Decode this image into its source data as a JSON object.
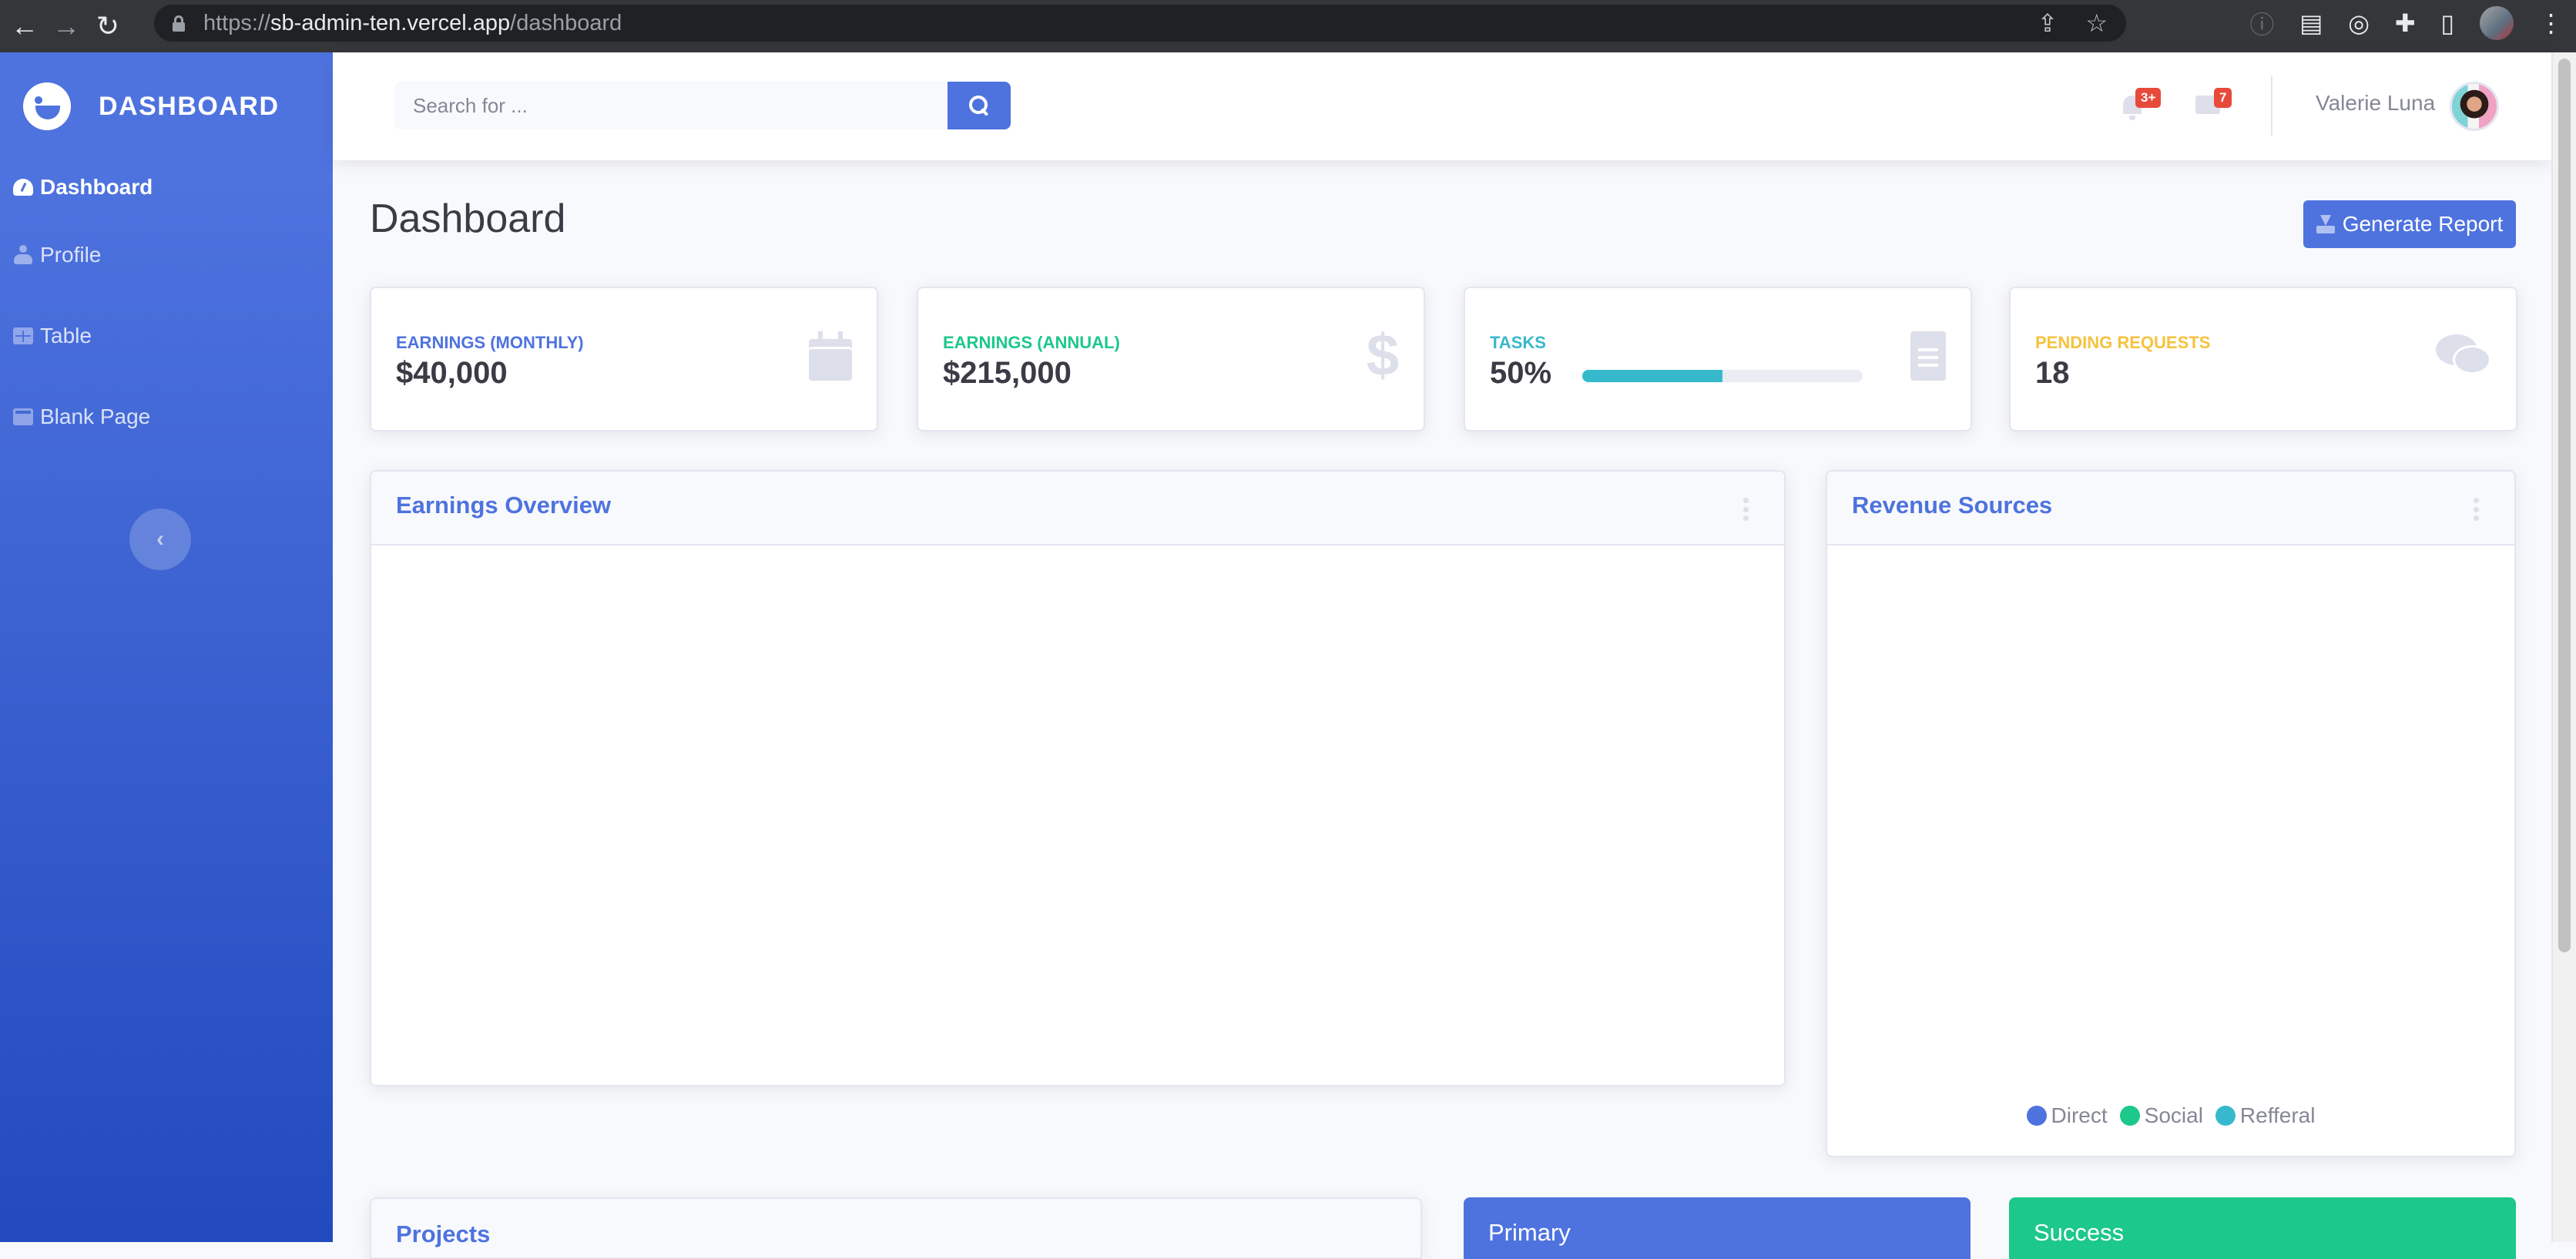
{
  "browser": {
    "url_scheme": "https://",
    "url_host": "sb-admin-ten.vercel.app",
    "url_path": "/dashboard"
  },
  "sidebar": {
    "brand": "DASHBOARD",
    "items": [
      {
        "label": "Dashboard",
        "icon": "tachometer-icon",
        "active": true
      },
      {
        "label": "Profile",
        "icon": "user-icon",
        "active": false
      },
      {
        "label": "Table",
        "icon": "table-icon",
        "active": false
      },
      {
        "label": "Blank Page",
        "icon": "window-icon",
        "active": false
      }
    ],
    "toggle_glyph": "‹"
  },
  "topbar": {
    "search_placeholder": "Search for ...",
    "alerts_badge": "3+",
    "messages_badge": "7",
    "user_name": "Valerie Luna"
  },
  "page": {
    "title": "Dashboard",
    "generate_report_label": "Generate Report"
  },
  "stats": [
    {
      "label": "Earnings (Monthly)",
      "value": "$40,000",
      "color": "#4e73df",
      "icon": "calendar-icon"
    },
    {
      "label": "Earnings (Annual)",
      "value": "$215,000",
      "color": "#1cc88a",
      "icon": "dollar-icon"
    },
    {
      "label": "Tasks",
      "value": "50%",
      "progress_percent": 50,
      "color": "#36b9cc",
      "icon": "clipboard-list-icon"
    },
    {
      "label": "Pending Requests",
      "value": "18",
      "color": "#f6c23e",
      "icon": "comments-icon"
    }
  ],
  "cards": {
    "earnings_overview_title": "Earnings Overview",
    "revenue_sources_title": "Revenue Sources",
    "revenue_legend": [
      {
        "label": "Direct",
        "color": "#4e73df"
      },
      {
        "label": "Social",
        "color": "#1cc88a"
      },
      {
        "label": "Refferal",
        "color": "#36b9cc"
      }
    ],
    "projects_title": "Projects",
    "primary_title": "Primary",
    "success_title": "Success"
  },
  "colors": {
    "primary": "#4e73df",
    "success": "#1cc88a",
    "info": "#36b9cc",
    "warning": "#f6c23e",
    "danger": "#e74a3b"
  }
}
